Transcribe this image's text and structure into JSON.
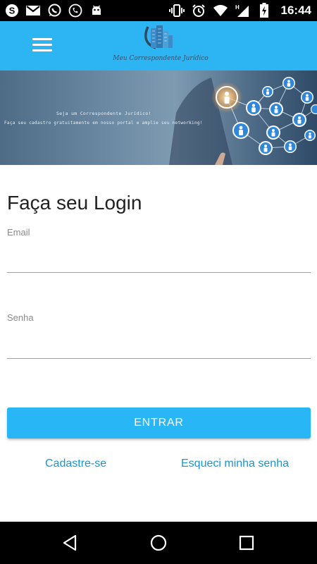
{
  "status_bar": {
    "time": "16:44",
    "left_icons": [
      "skype-icon",
      "gmail-icon",
      "whatsapp-icon",
      "phone-call-icon",
      "android-icon"
    ],
    "right_icons": [
      "vibrate-icon",
      "alarm-icon",
      "wifi-icon",
      "signal-h-icon",
      "battery-charging-icon"
    ]
  },
  "app_bar": {
    "background": "#2cb5f2",
    "logo_text": "Meu Correspondente Jurídico"
  },
  "banner": {
    "line1": "Seja um Correspondente Jurídico!",
    "line2": "Faça seu cadastro gratuitamente em nosso portal e amplie seu networking!"
  },
  "form": {
    "title": "Faça seu Login",
    "email_label": "Email",
    "email_value": "",
    "password_label": "Senha",
    "password_value": "",
    "submit_label": "ENTRAR",
    "register_link": "Cadastre-se",
    "forgot_link": "Esqueci minha senha",
    "accent": "#29b6f6"
  },
  "nav_bar": {
    "buttons": [
      "back-icon",
      "home-icon",
      "recents-icon"
    ]
  }
}
